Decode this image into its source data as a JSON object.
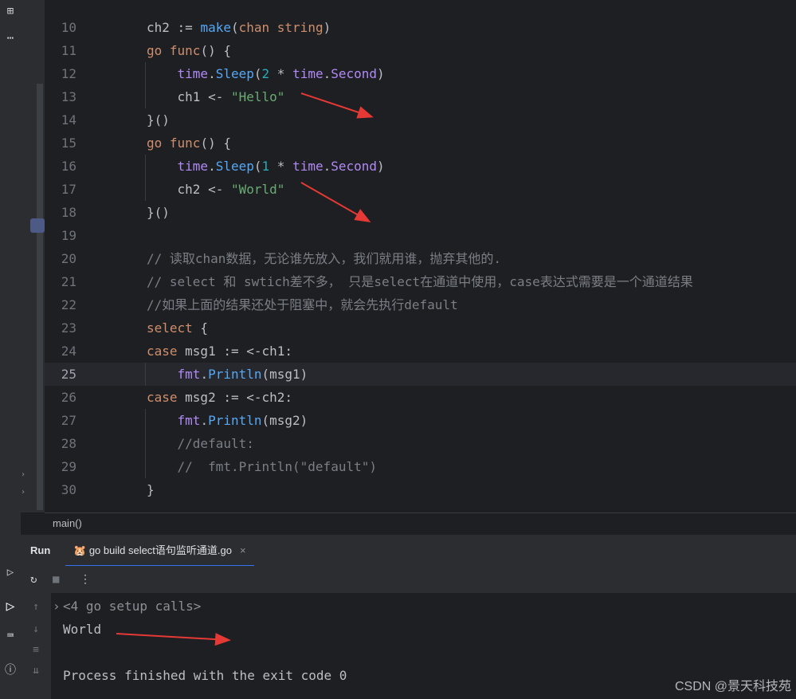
{
  "editor": {
    "lines": [
      {
        "num": "10",
        "tokens": [
          [
            "id",
            "ch2 := "
          ],
          [
            "fn",
            "make"
          ],
          [
            "id",
            "("
          ],
          [
            "kw",
            "chan"
          ],
          [
            "id",
            " "
          ],
          [
            "kw",
            "string"
          ],
          [
            "id",
            ")"
          ]
        ]
      },
      {
        "num": "11",
        "tokens": [
          [
            "kw",
            "go"
          ],
          [
            "id",
            " "
          ],
          [
            "kw",
            "func"
          ],
          [
            "id",
            "() {"
          ]
        ]
      },
      {
        "num": "12",
        "tokens": [
          [
            "id",
            "    "
          ],
          [
            "pkg",
            "time"
          ],
          [
            "id",
            "."
          ],
          [
            "fn",
            "Sleep"
          ],
          [
            "id",
            "("
          ],
          [
            "num",
            "2"
          ],
          [
            "id",
            " * "
          ],
          [
            "pkg",
            "time"
          ],
          [
            "id",
            "."
          ],
          [
            "pkg",
            "Second"
          ],
          [
            "id",
            ")"
          ]
        ]
      },
      {
        "num": "13",
        "tokens": [
          [
            "id",
            "    ch1 <- "
          ],
          [
            "str",
            "\"Hello\""
          ]
        ]
      },
      {
        "num": "14",
        "tokens": [
          [
            "id",
            "}()"
          ]
        ]
      },
      {
        "num": "15",
        "tokens": [
          [
            "kw",
            "go"
          ],
          [
            "id",
            " "
          ],
          [
            "kw",
            "func"
          ],
          [
            "id",
            "() {"
          ]
        ]
      },
      {
        "num": "16",
        "tokens": [
          [
            "id",
            "    "
          ],
          [
            "pkg",
            "time"
          ],
          [
            "id",
            "."
          ],
          [
            "fn",
            "Sleep"
          ],
          [
            "id",
            "("
          ],
          [
            "num",
            "1"
          ],
          [
            "id",
            " * "
          ],
          [
            "pkg",
            "time"
          ],
          [
            "id",
            "."
          ],
          [
            "pkg",
            "Second"
          ],
          [
            "id",
            ")"
          ]
        ]
      },
      {
        "num": "17",
        "tokens": [
          [
            "id",
            "    ch2 <- "
          ],
          [
            "str",
            "\"World\""
          ]
        ]
      },
      {
        "num": "18",
        "tokens": [
          [
            "id",
            "}()"
          ]
        ]
      },
      {
        "num": "19",
        "tokens": []
      },
      {
        "num": "20",
        "tokens": [
          [
            "cm",
            "// 读取chan数据，无论谁先放入，我们就用谁，抛弃其他的."
          ]
        ]
      },
      {
        "num": "21",
        "tokens": [
          [
            "cm",
            "// select 和 swtich差不多， 只是select在通道中使用，case表达式需要是一个通道结果"
          ]
        ]
      },
      {
        "num": "22",
        "tokens": [
          [
            "cm",
            "//如果上面的结果还处于阻塞中，就会先执行default"
          ]
        ]
      },
      {
        "num": "23",
        "tokens": [
          [
            "kw",
            "select"
          ],
          [
            "id",
            " {"
          ]
        ]
      },
      {
        "num": "24",
        "tokens": [
          [
            "kw",
            "case"
          ],
          [
            "id",
            " msg1 := <-ch1:"
          ]
        ]
      },
      {
        "num": "25",
        "tokens": [
          [
            "id",
            "    "
          ],
          [
            "pkg",
            "fmt"
          ],
          [
            "id",
            "."
          ],
          [
            "fn",
            "Println"
          ],
          [
            "id",
            "(msg1)"
          ]
        ]
      },
      {
        "num": "26",
        "tokens": [
          [
            "kw",
            "case"
          ],
          [
            "id",
            " msg2 := <-ch2:"
          ]
        ]
      },
      {
        "num": "27",
        "tokens": [
          [
            "id",
            "    "
          ],
          [
            "pkg",
            "fmt"
          ],
          [
            "id",
            "."
          ],
          [
            "fn",
            "Println"
          ],
          [
            "id",
            "(msg2)"
          ]
        ]
      },
      {
        "num": "28",
        "tokens": [
          [
            "cm",
            "    //default:"
          ]
        ]
      },
      {
        "num": "29",
        "tokens": [
          [
            "cm",
            "    //  fmt.Println(\"default\")"
          ]
        ]
      },
      {
        "num": "30",
        "tokens": [
          [
            "id",
            "}"
          ]
        ]
      }
    ],
    "current_line": "25"
  },
  "breadcrumb": "main()",
  "run_panel": {
    "title": "Run",
    "tab_label": "go build select语句监听通道.go",
    "tab_close": "×",
    "console": {
      "setup_calls": "<4 go setup calls>",
      "output": "World",
      "exit_message": "Process finished with the exit code 0"
    }
  },
  "watermark": "CSDN @景天科技苑",
  "colors": {
    "background": "#1e1f22",
    "keyword": "#cf8e6d",
    "function": "#56a8f5",
    "string": "#6aab73",
    "annotation_arrow": "#e53935"
  }
}
